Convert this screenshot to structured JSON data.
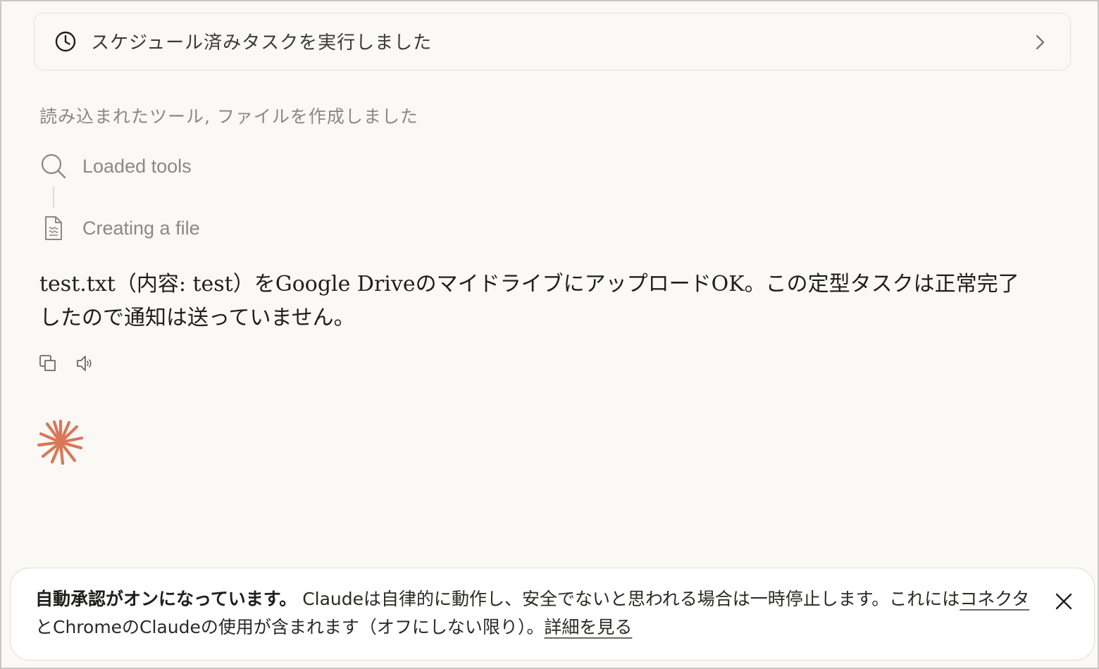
{
  "scheduled_task": {
    "label": "スケジュール済みタスクを実行しました",
    "icon": "clock-icon",
    "expand_icon": "chevron-right-icon"
  },
  "steps": {
    "summary": "読み込まれたツール, ファイルを作成しました",
    "items": [
      {
        "label": "Loaded tools",
        "icon": "search-icon"
      },
      {
        "label": "Creating a file",
        "icon": "file-icon"
      }
    ]
  },
  "message": {
    "text": "test.txt（内容: test）をGoogle DriveのマイドライブにアップロードOK。この定型タスクは正常完了したので通知は送っていません。"
  },
  "message_actions": [
    {
      "name": "copy-icon"
    },
    {
      "name": "speaker-icon"
    }
  ],
  "notice": {
    "bold": "自動承認がオンになっています。",
    "part1": " Claudeは自律的に動作し、安全でないと思われる場合は一時停止します。これには",
    "link_connectors": "コネクタ",
    "part2": "とChromeのClaudeの使用が含まれます（オフにしない限り）。",
    "link_details": "詳細を見る",
    "close_icon": "close-icon"
  },
  "colors": {
    "background": "#faf9f6",
    "accent": "#d97757",
    "muted_text": "#8a8884"
  }
}
